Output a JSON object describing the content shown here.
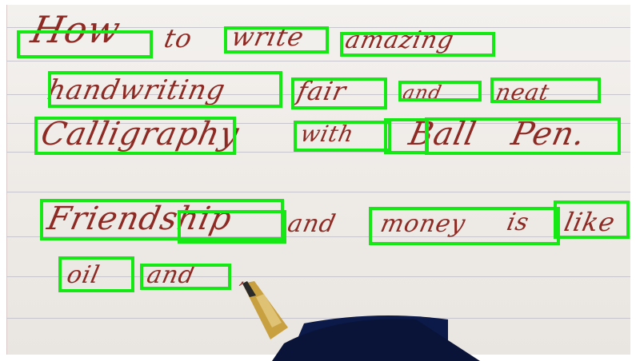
{
  "lines": [
    {
      "words": [
        "How",
        "to",
        "write",
        "amazing"
      ]
    },
    {
      "words": [
        "handwriting",
        "fair",
        "and",
        "neat"
      ]
    },
    {
      "words": [
        "Calligraphy",
        "with",
        "Ball",
        "Pen."
      ]
    },
    {
      "words": [
        "Friendship",
        "and",
        "money",
        "is",
        "like"
      ]
    },
    {
      "words": [
        "oil",
        "and"
      ]
    }
  ],
  "colors": {
    "ink": "#8e2a24",
    "box": "#16e816",
    "paper": "#efebe7",
    "rule": "#c8c6cc",
    "pen_body": "#0c1a4a",
    "pen_tip": "#c8a040"
  },
  "detections": [
    {
      "id": "det-how"
    },
    {
      "id": "det-write"
    },
    {
      "id": "det-amazing"
    },
    {
      "id": "det-handwriting"
    },
    {
      "id": "det-fair"
    },
    {
      "id": "det-and-1"
    },
    {
      "id": "det-neat"
    },
    {
      "id": "det-calligraphy"
    },
    {
      "id": "det-with"
    },
    {
      "id": "det-ball-b"
    },
    {
      "id": "det-ball-pen"
    },
    {
      "id": "det-friend"
    },
    {
      "id": "det-ship-and"
    },
    {
      "id": "det-money-is"
    },
    {
      "id": "det-like"
    },
    {
      "id": "det-oil"
    },
    {
      "id": "det-and-2"
    }
  ]
}
